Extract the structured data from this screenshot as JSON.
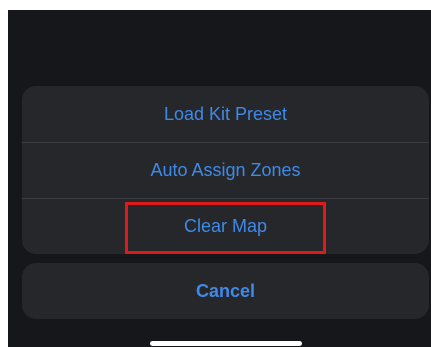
{
  "action_sheet": {
    "items": [
      {
        "label": "Load Kit Preset"
      },
      {
        "label": "Auto Assign Zones"
      },
      {
        "label": "Clear Map"
      }
    ],
    "cancel_label": "Cancel",
    "highlighted_item": "Clear Map"
  },
  "colors": {
    "accent": "#3f8ae8",
    "background": "#15171b",
    "sheet": "#25272b",
    "highlight": "#e01919"
  }
}
